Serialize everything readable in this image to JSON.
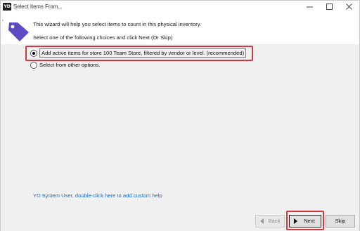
{
  "window": {
    "app_icon_text": "YD",
    "title": "Select Items From..."
  },
  "header": {
    "intro": "This wizard will help you select items to count in this physical inventory.",
    "prompt": "Select one of the following choices and click Next (Or Skip)"
  },
  "options": [
    {
      "label": "Add active items for store 100 Team Store, filtered by vendor or level. (recommended)",
      "selected": true
    },
    {
      "label": "Select from other options.",
      "selected": false
    }
  ],
  "help_link": "YD System User, double-click here to add custom help",
  "buttons": {
    "back": "Back",
    "next": "Next",
    "skip": "Skip"
  },
  "colors": {
    "highlight": "#d0393f",
    "link": "#1e6fbf",
    "tag_icon": "#5b4bc4"
  }
}
